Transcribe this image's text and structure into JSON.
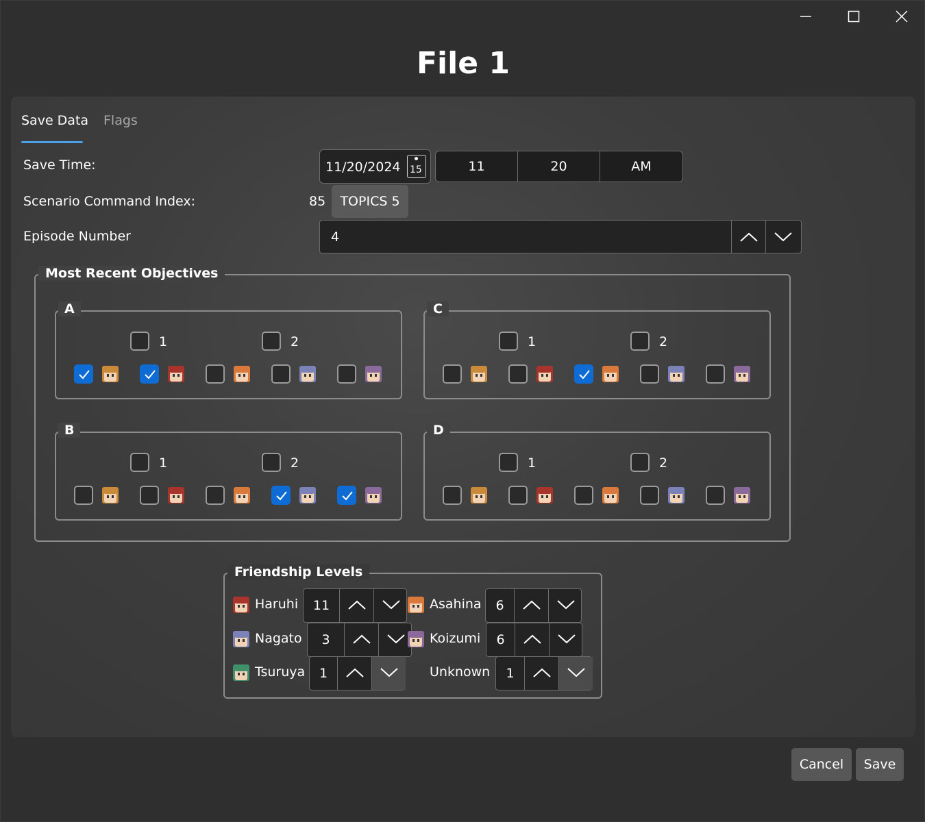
{
  "window": {
    "title": "File 1"
  },
  "tabs": [
    {
      "label": "Save Data",
      "active": true
    },
    {
      "label": "Flags",
      "active": false
    }
  ],
  "save_time": {
    "label": "Save Time:",
    "date": "11/20/2024",
    "calendar_day": "15",
    "hour": "11",
    "minute": "20",
    "ampm": "AM"
  },
  "scenario": {
    "label": "Scenario Command Index:",
    "index": "85",
    "command": "TOPICS 5"
  },
  "episode": {
    "label": "Episode Number",
    "value": "4"
  },
  "objectives": {
    "title": "Most Recent Objectives",
    "groups": [
      {
        "letter": "A",
        "num1": "1",
        "num2": "2",
        "top": [
          false,
          false
        ],
        "chars": [
          true,
          true,
          false,
          false,
          false
        ]
      },
      {
        "letter": "C",
        "num1": "1",
        "num2": "2",
        "top": [
          false,
          false
        ],
        "chars": [
          false,
          false,
          true,
          false,
          false
        ]
      },
      {
        "letter": "B",
        "num1": "1",
        "num2": "2",
        "top": [
          false,
          false
        ],
        "chars": [
          false,
          false,
          false,
          true,
          true
        ]
      },
      {
        "letter": "D",
        "num1": "1",
        "num2": "2",
        "top": [
          false,
          false
        ],
        "chars": [
          false,
          false,
          false,
          false,
          false
        ]
      }
    ],
    "avatar_colors": [
      "#c98a3a",
      "#a8342c",
      "#d97a3c",
      "#7b82b8",
      "#8a6a9a"
    ]
  },
  "friendship": {
    "title": "Friendship Levels",
    "rows": [
      {
        "name": "Haruhi",
        "value": "11",
        "avatar": "#a8342c"
      },
      {
        "name": "Asahina",
        "value": "6",
        "avatar": "#d97a3c"
      },
      {
        "name": "Nagato",
        "value": "3",
        "avatar": "#7b82b8"
      },
      {
        "name": "Koizumi",
        "value": "6",
        "avatar": "#8a6a9a"
      },
      {
        "name": "Tsuruya",
        "value": "1",
        "avatar": "#3f8f6a"
      },
      {
        "name": "Unknown",
        "value": "1",
        "avatar": ""
      }
    ]
  },
  "dialog": {
    "cancel": "Cancel",
    "save": "Save"
  }
}
